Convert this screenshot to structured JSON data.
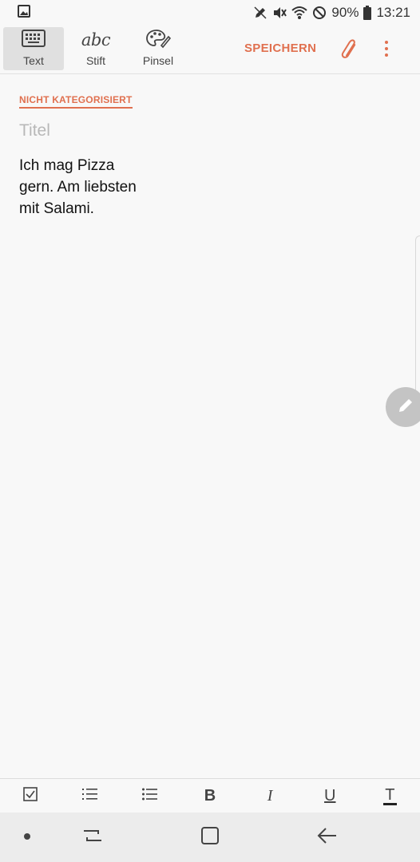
{
  "status_bar": {
    "battery": "90%",
    "time": "13:21"
  },
  "toolbar": {
    "tabs": [
      {
        "label": "Text",
        "icon": "keyboard-icon",
        "active": true
      },
      {
        "label": "Stift",
        "icon": "abc",
        "active": false
      },
      {
        "label": "Pinsel",
        "icon": "palette-icon",
        "active": false
      }
    ],
    "save_label": "SPEICHERN",
    "attach_icon": "paperclip-icon",
    "more_icon": "more-vert-icon"
  },
  "note": {
    "category": "NICHT KATEGORISIERT",
    "title_placeholder": "Titel",
    "body": "Ich mag Pizza gern. Am liebsten mit Salami."
  },
  "format_bar": {
    "items": [
      "checkbox-icon",
      "numbered-list-icon",
      "bullet-list-icon",
      "B",
      "I",
      "U",
      "T"
    ]
  },
  "colors": {
    "accent": "#e0704f",
    "background": "#f8f8f8",
    "active_tab": "#e0e0e0",
    "fab": "#c4c4c4"
  }
}
